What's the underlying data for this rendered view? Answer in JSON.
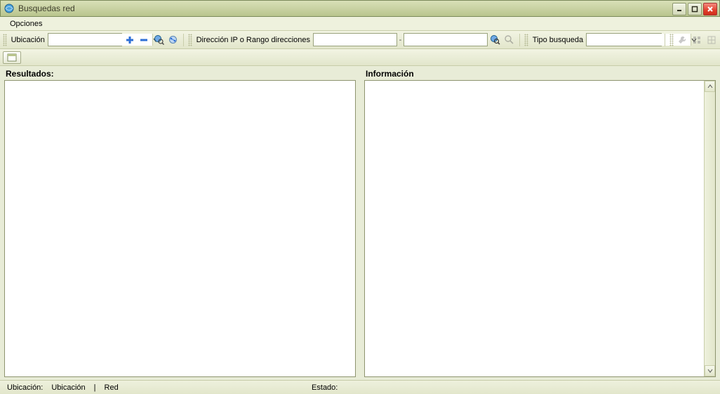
{
  "window": {
    "title": "Busquedas red"
  },
  "menu": {
    "opciones": "Opciones"
  },
  "toolbar": {
    "ubicacion_label": "Ubicación",
    "ubicacion_value": "",
    "ip_label": "Dirección IP o Rango direcciones",
    "ip_from": "",
    "ip_to": "",
    "ip_range_sep": "-",
    "tipo_label": "Tipo busqueda",
    "tipo_value": ""
  },
  "headers": {
    "resultados": "Resultados:",
    "informacion": "Información"
  },
  "status": {
    "ubicacion_label": "Ubicación:",
    "ubicacion_value": "Ubicación",
    "sep": "|",
    "red_value": "Red",
    "estado_label": "Estado:",
    "estado_value": ""
  }
}
